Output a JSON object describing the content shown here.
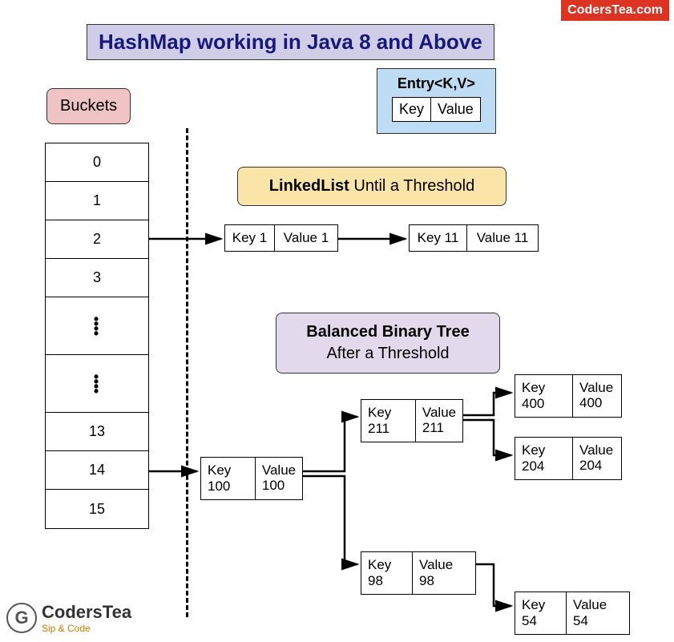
{
  "brand_tag": "CodersTea.com",
  "title": "HashMap working in Java 8 and Above",
  "buckets_label": "Buckets",
  "buckets": [
    "0",
    "1",
    "2",
    "3",
    "",
    "",
    "13",
    "14",
    "15"
  ],
  "entry": {
    "title": "Entry<K,V>",
    "key_label": "Key",
    "value_label": "Value"
  },
  "linkedlist_label": {
    "bold": "LinkedList",
    "rest": " Until a Threshold"
  },
  "balancedtree_label": {
    "bold": "Balanced Binary Tree",
    "rest": "After a Threshold"
  },
  "ll_nodes": [
    {
      "key": "Key 1",
      "value": "Value 1"
    },
    {
      "key": "Key 11",
      "value": "Value 11"
    }
  ],
  "tree_nodes": {
    "root": {
      "key": "Key 100",
      "value": "Value 100"
    },
    "n211": {
      "key": "Key 211",
      "value": "Value 211"
    },
    "n400": {
      "key": "Key 400",
      "value": "Value 400"
    },
    "n204": {
      "key": "Key 204",
      "value": "Value 204"
    },
    "n98": {
      "key": "Key 98",
      "value": "Value 98"
    },
    "n54": {
      "key": "Key 54",
      "value": "Value 54"
    }
  },
  "logo": {
    "icon_letter": "G",
    "top": "CodersTea",
    "bottom": "Sip & Code"
  }
}
